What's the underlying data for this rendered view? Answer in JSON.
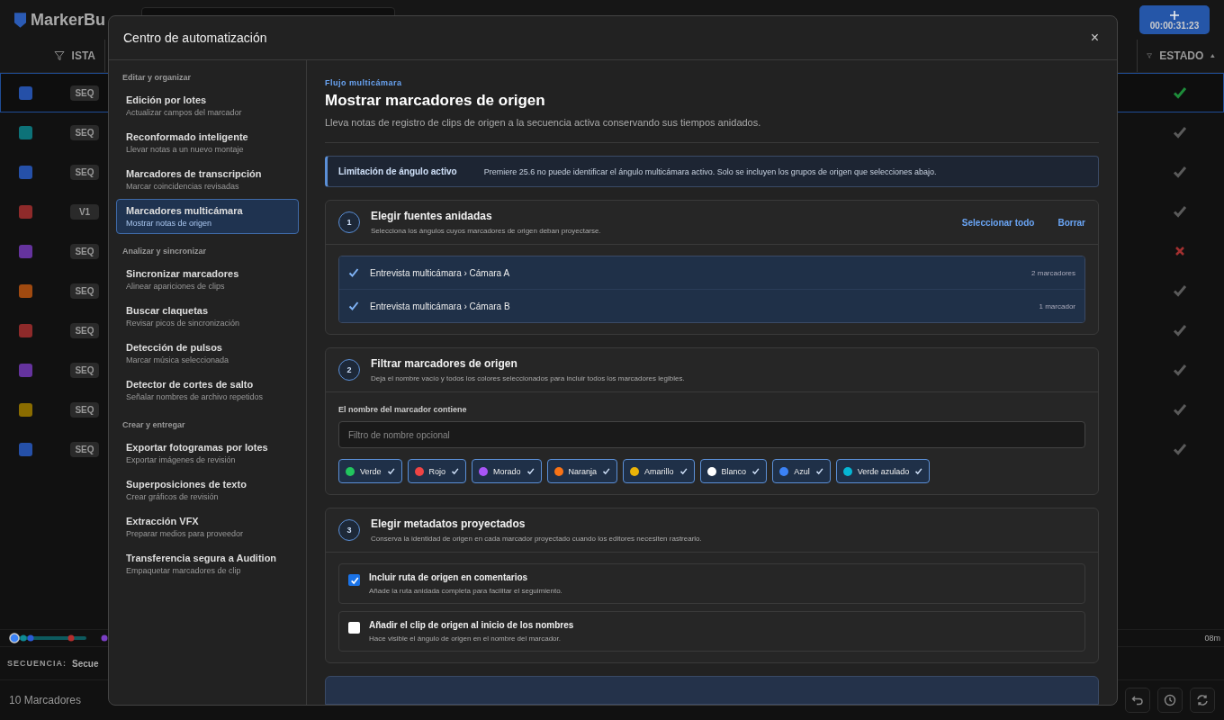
{
  "app": {
    "logo": "MarkerBu",
    "timecode_button": "00:00:31:23",
    "table": {
      "columns": [
        {
          "label": "ISTA"
        },
        {
          "label": "ESTADO"
        }
      ],
      "rows": [
        {
          "color": "#2550a8",
          "badge": "SEQ",
          "status": {
            "kind": "check",
            "color": "#1e8c3a"
          },
          "selected": true
        },
        {
          "color": "#0d7278",
          "badge": "SEQ",
          "status": {
            "kind": "check",
            "color": "#5a5a5a"
          },
          "selected": false
        },
        {
          "color": "#2550a8",
          "badge": "SEQ",
          "status": {
            "kind": "check",
            "color": "#5a5a5a"
          },
          "selected": false
        },
        {
          "color": "#8e2a2a",
          "badge": "V1",
          "status": {
            "kind": "check",
            "color": "#5a5a5a"
          },
          "selected": false
        },
        {
          "color": "#65339e",
          "badge": "SEQ",
          "status": {
            "kind": "cross",
            "color": "#a33030"
          },
          "selected": false
        },
        {
          "color": "#a04a10",
          "badge": "SEQ",
          "status": {
            "kind": "check",
            "color": "#5a5a5a"
          },
          "selected": false
        },
        {
          "color": "#8e2a2a",
          "badge": "SEQ",
          "status": {
            "kind": "check",
            "color": "#5a5a5a"
          },
          "selected": false
        },
        {
          "color": "#65339e",
          "badge": "SEQ",
          "status": {
            "kind": "check",
            "color": "#5a5a5a"
          },
          "selected": false
        },
        {
          "color": "#8a6c00",
          "badge": "SEQ",
          "status": {
            "kind": "check",
            "color": "#5a5a5a"
          },
          "selected": false
        },
        {
          "color": "#2550a8",
          "badge": "SEQ",
          "status": {
            "kind": "check",
            "color": "#5a5a5a"
          },
          "selected": false
        }
      ]
    },
    "timeline": {
      "end_label": "08m"
    },
    "sequence_label": "SECUENCIA:",
    "sequence_name": "Secue",
    "marker_count": "10 Marcadores"
  },
  "dialog": {
    "title": "Centro de automatización",
    "close": "×",
    "sidebar": [
      {
        "heading": "Editar y organizar",
        "items": [
          {
            "title": "Edición por lotes",
            "subtitle": "Actualizar campos del marcador",
            "selected": false
          },
          {
            "title": "Reconformado inteligente",
            "subtitle": "Llevar notas a un nuevo montaje",
            "selected": false
          },
          {
            "title": "Marcadores de transcripción",
            "subtitle": "Marcar coincidencias revisadas",
            "selected": false
          },
          {
            "title": "Marcadores multicámara",
            "subtitle": "Mostrar notas de origen",
            "selected": true
          }
        ]
      },
      {
        "heading": "Analizar y sincronizar",
        "items": [
          {
            "title": "Sincronizar marcadores",
            "subtitle": "Alinear apariciones de clips",
            "selected": false
          },
          {
            "title": "Buscar claquetas",
            "subtitle": "Revisar picos de sincronización",
            "selected": false
          },
          {
            "title": "Detección de pulsos",
            "subtitle": "Marcar música seleccionada",
            "selected": false
          },
          {
            "title": "Detector de cortes de salto",
            "subtitle": "Señalar nombres de archivo repetidos",
            "selected": false
          }
        ]
      },
      {
        "heading": "Crear y entregar",
        "items": [
          {
            "title": "Exportar fotogramas por lotes",
            "subtitle": "Exportar imágenes de revisión",
            "selected": false
          },
          {
            "title": "Superposiciones de texto",
            "subtitle": "Crear gráficos de revisión",
            "selected": false
          },
          {
            "title": "Extracción VFX",
            "subtitle": "Preparar medios para proveedor",
            "selected": false
          },
          {
            "title": "Transferencia segura a Audition",
            "subtitle": "Empaquetar marcadores de clip",
            "selected": false
          }
        ]
      }
    ],
    "eyebrow": "Flujo multicámara",
    "heading": "Mostrar marcadores de origen",
    "description": "Lleva notas de registro de clips de origen a la secuencia activa conservando sus tiempos anidados.",
    "notice": {
      "title": "Limitación de ángulo activo",
      "text": "Premiere 25.6 no puede identificar el ángulo multicámara activo. Solo se incluyen los grupos de origen que selecciones abajo."
    },
    "step1": {
      "number": "1",
      "title": "Elegir fuentes anidadas",
      "subtitle": "Selecciona los ángulos cuyos marcadores de origen deban proyectarse.",
      "actions": [
        "Seleccionar todo",
        "Borrar"
      ],
      "sources": [
        {
          "label": "Entrevista multicámara › Cámara A",
          "count": "2 marcadores",
          "checked": true
        },
        {
          "label": "Entrevista multicámara › Cámara B",
          "count": "1 marcador",
          "checked": true
        }
      ]
    },
    "step2": {
      "number": "2",
      "title": "Filtrar marcadores de origen",
      "subtitle": "Deja el nombre vacío y todos los colores seleccionados para incluir todos los marcadores legibles.",
      "field_label": "El nombre del marcador contiene",
      "placeholder": "Filtro de nombre opcional",
      "colors": [
        {
          "label": "Verde",
          "color": "#22c55e",
          "checked": true
        },
        {
          "label": "Rojo",
          "color": "#ef4444",
          "checked": true
        },
        {
          "label": "Morado",
          "color": "#a855f7",
          "checked": true
        },
        {
          "label": "Naranja",
          "color": "#f97316",
          "checked": true
        },
        {
          "label": "Amarillo",
          "color": "#eab308",
          "checked": true
        },
        {
          "label": "Blanco",
          "color": "#ffffff",
          "checked": true
        },
        {
          "label": "Azul",
          "color": "#3b82f6",
          "checked": true
        },
        {
          "label": "Verde azulado",
          "color": "#06b6d4",
          "checked": true
        }
      ]
    },
    "step3": {
      "number": "3",
      "title": "Elegir metadatos proyectados",
      "subtitle": "Conserva la identidad de origen en cada marcador proyectado cuando los editores necesiten rastrearlo.",
      "options": [
        {
          "title": "Incluir ruta de origen en comentarios",
          "description": "Añade la ruta anidada completa para facilitar el seguimiento.",
          "checked": true
        },
        {
          "title": "Añadir el clip de origen al inicio de los nombres",
          "description": "Hace visible el ángulo de origen en el nombre del marcador.",
          "checked": false
        }
      ]
    }
  }
}
